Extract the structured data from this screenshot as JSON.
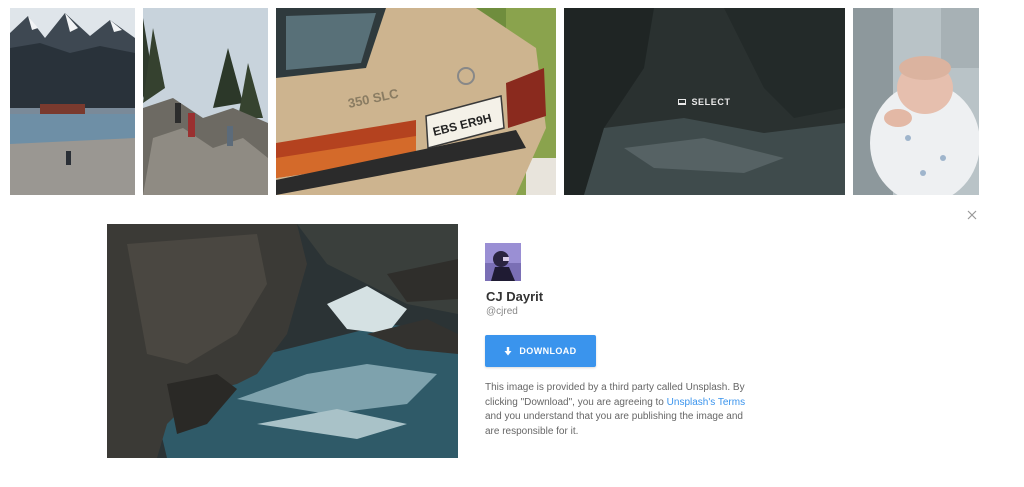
{
  "gallery": {
    "tiles": [
      {
        "subject": "mountain-lake"
      },
      {
        "subject": "hikers-rocks"
      },
      {
        "subject": "vintage-car",
        "plate": "EBS ER9H",
        "badge": "350 SLC"
      },
      {
        "subject": "sea-cliffs",
        "overlay_label": "SELECT"
      },
      {
        "subject": "newborn-baby"
      }
    ]
  },
  "detail": {
    "close_icon": "close-icon",
    "author": {
      "name": "CJ Dayrit",
      "handle": "@cjred"
    },
    "download": {
      "label": "DOWNLOAD",
      "icon": "download-arrow-icon"
    },
    "disclaimer": {
      "prefix": "This image is provided by a third party called Unsplash. By clicking \"Download\", you are agreeing to ",
      "link": "Unsplash's Terms",
      "suffix": " and you understand that you are publishing the image and are responsible for it."
    }
  },
  "colors": {
    "accent": "#3a94ed",
    "text": "#333333",
    "muted": "#888888"
  }
}
